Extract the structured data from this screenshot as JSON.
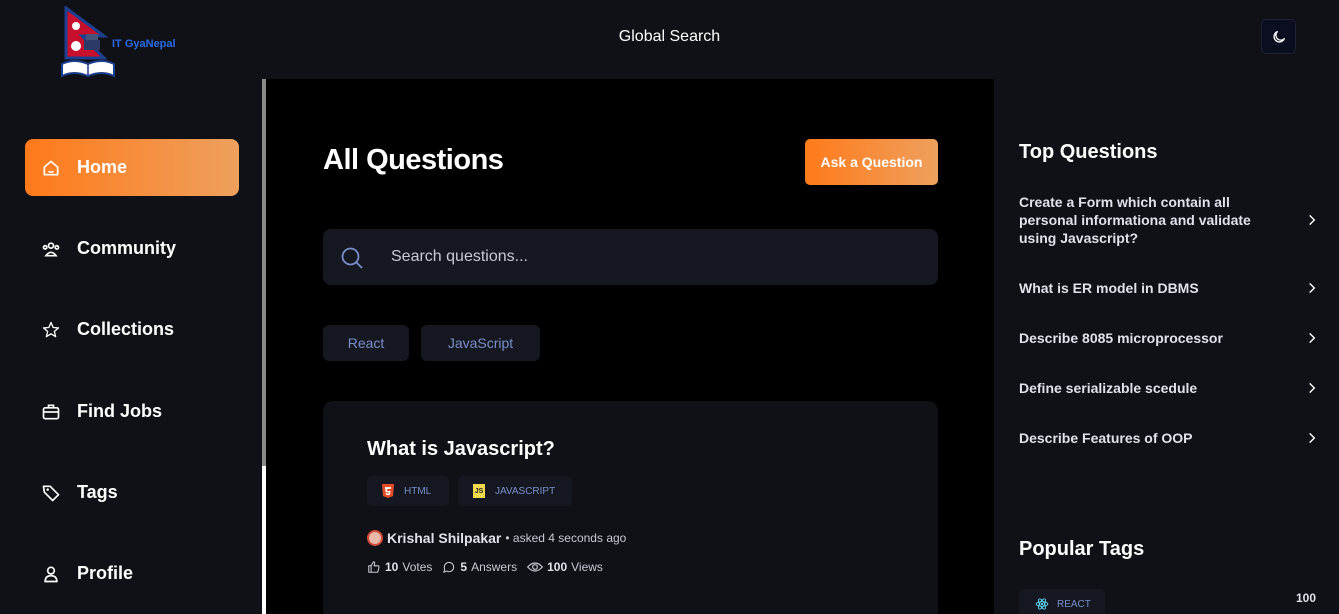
{
  "header": {
    "logo_text": "IT GyaNepal",
    "global_search_label": "Global Search",
    "theme_icon": "moon-icon"
  },
  "sidebar": {
    "items": [
      {
        "label": "Home",
        "icon": "home-icon",
        "active": true
      },
      {
        "label": "Community",
        "icon": "users-icon",
        "active": false
      },
      {
        "label": "Collections",
        "icon": "star-icon",
        "active": false
      },
      {
        "label": "Find Jobs",
        "icon": "briefcase-icon",
        "active": false
      },
      {
        "label": "Tags",
        "icon": "tag-icon",
        "active": false
      },
      {
        "label": "Profile",
        "icon": "user-icon",
        "active": false
      }
    ]
  },
  "main": {
    "title": "All Questions",
    "ask_button": "Ask a Question",
    "search_placeholder": "Search questions...",
    "filters": [
      "React",
      "JavaScript"
    ],
    "question": {
      "title": "What is Javascript?",
      "tags": [
        {
          "label": "HTML",
          "icon": "html5-icon",
          "color": "#e44d26"
        },
        {
          "label": "JAVASCRIPT",
          "icon": "js-icon",
          "color": "#f0db4f"
        }
      ],
      "author": "Krishal Shilpakar",
      "asked": "• asked 4 seconds ago",
      "votes": "10",
      "votes_label": "Votes",
      "answers": "5",
      "answers_label": "Answers",
      "views": "100",
      "views_label": "Views"
    }
  },
  "rightbar": {
    "top_questions_heading": "Top Questions",
    "top_questions": [
      "Create a Form which contain all personal informationa and validate using Javascript?",
      "What is ER model in DBMS",
      "Describe 8085 microprocessor",
      "Define serializable scedule",
      "Describe Features of OOP"
    ],
    "popular_tags_heading": "Popular Tags",
    "popular_tags": [
      {
        "label": "REACT",
        "count": "100",
        "icon": "react-icon"
      }
    ]
  },
  "colors": {
    "accent_start": "#ff7a1a",
    "accent_end": "#eea05e",
    "panel_bg": "#0f1116",
    "chip_bg": "#151821",
    "chip_text": "#7b8ec8"
  }
}
